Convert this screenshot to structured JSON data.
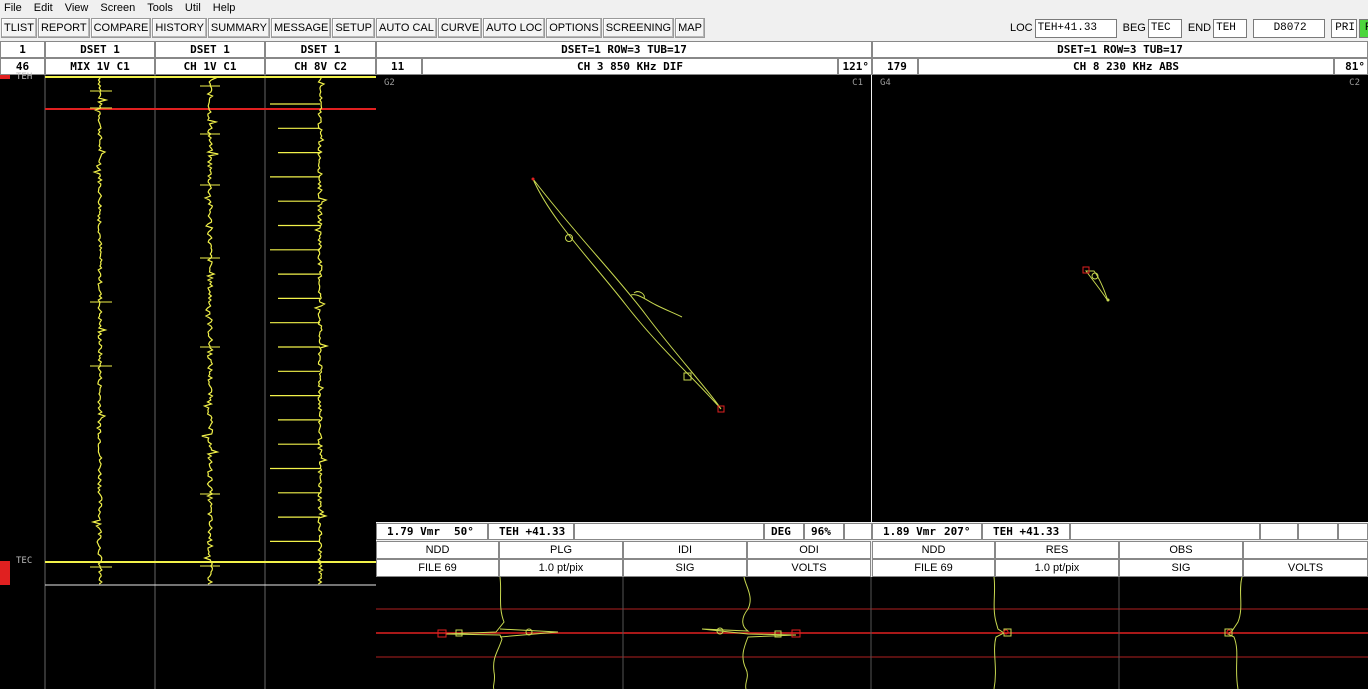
{
  "menu": [
    "File",
    "Edit",
    "View",
    "Screen",
    "Tools",
    "Util",
    "Help"
  ],
  "toolbar": [
    "TLIST",
    "REPORT",
    "COMPARE",
    "HISTORY",
    "SUMMARY",
    "MESSAGE",
    "SETUP",
    "AUTO CAL",
    "CURVE",
    "AUTO LOC",
    "OPTIONS",
    "SCREENING",
    "MAP"
  ],
  "location": {
    "loc_label": "LOC",
    "loc_value": "TEH+41.33",
    "beg_label": "BEG",
    "beg_value": "TEC",
    "end_label": "END",
    "end_value": "TEH",
    "id_value": "D8072",
    "pri_label": "PRI",
    "flag_value": "F"
  },
  "strips": [
    {
      "header_top": "1",
      "header_bot": "46",
      "is_label": true
    },
    {
      "header_top": "DSET 1",
      "header_bot": "MIX 1V C1"
    },
    {
      "header_top": "DSET 1",
      "header_bot": "CH 1V C1"
    },
    {
      "header_top": "DSET 1",
      "header_bot": "CH 8V C2"
    }
  ],
  "strip_labels": {
    "top": "TEH",
    "bottom": "TEC"
  },
  "lissajous": [
    {
      "title": "DSET=1 ROW=3 TUB=17",
      "num": "11",
      "channel": "CH 3 850 KHz DIF",
      "angle": "121°",
      "g_label": "G2",
      "c_label": "C1",
      "status": {
        "vmr": "1.79 Vmr",
        "deg": "50°",
        "loc": "TEH +41.33",
        "deg_label": "DEG",
        "pct": "96%"
      },
      "tabs1": [
        "NDD",
        "PLG",
        "IDI",
        "ODI"
      ],
      "tabs2": [
        "FILE 69",
        "1.0 pt/pix",
        "SIG",
        "VOLTS"
      ]
    },
    {
      "title": "DSET=1 ROW=3 TUB=17",
      "num": "179",
      "channel": "CH 8 230 KHz ABS",
      "angle": "81°",
      "g_label": "G4",
      "c_label": "C2",
      "status": {
        "vmr": "1.89 Vmr",
        "deg": "207°",
        "loc": "TEH +41.33"
      },
      "tabs1": [
        "NDD",
        "RES",
        "OBS",
        ""
      ],
      "tabs2": [
        "FILE 69",
        "1.0 pt/pix",
        "SIG",
        "VOLTS"
      ]
    }
  ],
  "colors": {
    "signal": "#f2f24a",
    "marker": "#e02020",
    "trace": "#c8d850",
    "background": "#000000",
    "flag": "#4cd63c"
  }
}
